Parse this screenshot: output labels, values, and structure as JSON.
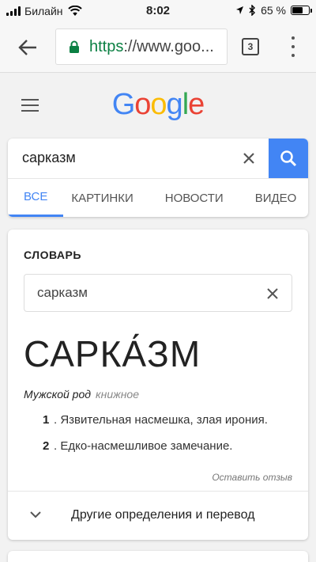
{
  "status_bar": {
    "carrier": "Билайн",
    "time": "8:02",
    "battery": "65 %",
    "battery_level": 0.65
  },
  "browser": {
    "url_scheme": "https",
    "url_rest": "://www.goo...",
    "tab_count": "3"
  },
  "google_logo": [
    "G",
    "o",
    "o",
    "g",
    "l",
    "e"
  ],
  "search": {
    "query": "сарказм",
    "tabs": [
      "ВСЕ",
      "КАРТИНКИ",
      "НОВОСТИ",
      "ВИДЕО"
    ],
    "active_tab": 0
  },
  "dictionary": {
    "title": "СЛОВАРЬ",
    "input_value": "сарказм",
    "headword": "САРКА́ЗМ",
    "part_of_speech": "Мужской род",
    "register": "книжное",
    "definitions": [
      {
        "num": "1",
        "text": "Язвительная насмешка, злая ирония."
      },
      {
        "num": "2",
        "text": "Едко-насмешливое замечание."
      }
    ],
    "feedback": "Оставить отзыв",
    "more_label": "Другие определения и перевод"
  },
  "colors": {
    "accent": "#4285f4",
    "secure": "#0b8043"
  }
}
